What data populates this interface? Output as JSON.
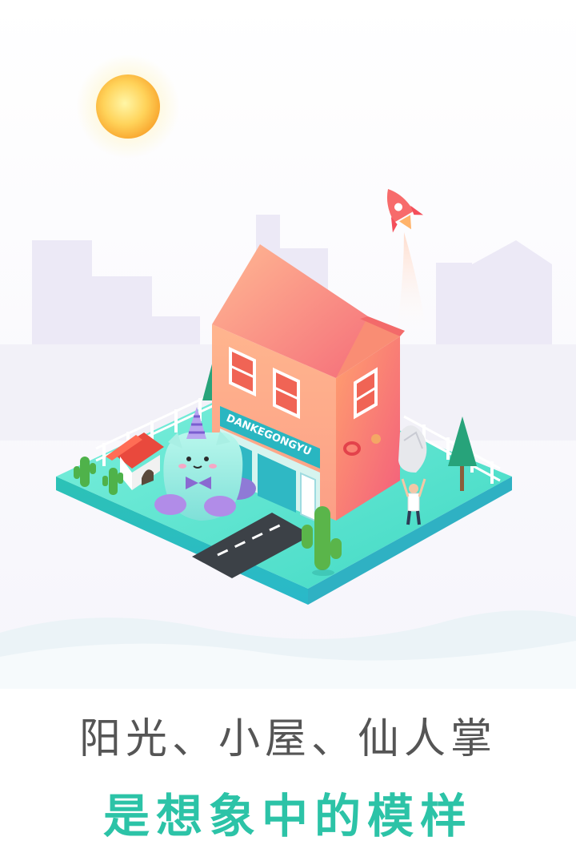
{
  "caption": {
    "line1": "阳光、小屋、仙人掌",
    "line2": "是想象中的模样"
  },
  "shop_sign": "DANKEGONGYU",
  "colors": {
    "accent": "#2cc3a7",
    "headline_gray": "#555555",
    "ground": "#3fd7c0",
    "house_roof": "#f98f7c",
    "house_wall": "#fba38c",
    "city_lavender": "#ece9f6"
  },
  "icons": [
    "sun-icon",
    "rocket-icon",
    "cloud-icon",
    "cactus-icon",
    "tree-icon",
    "dog-house-icon"
  ]
}
